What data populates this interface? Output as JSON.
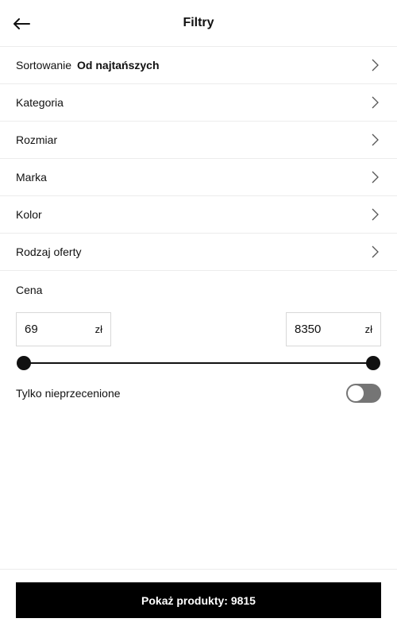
{
  "header": {
    "title": "Filtry",
    "back_icon": "arrow-left-icon"
  },
  "filters": [
    {
      "label": "Sortowanie",
      "value": "Od najtańszych"
    },
    {
      "label": "Kategoria"
    },
    {
      "label": "Rozmiar"
    },
    {
      "label": "Marka"
    },
    {
      "label": "Kolor"
    },
    {
      "label": "Rodzaj oferty"
    }
  ],
  "price": {
    "label": "Cena",
    "min": "69",
    "max": "8350",
    "currency": "zł"
  },
  "toggle": {
    "label": "Tylko nieprzecenione",
    "on": false
  },
  "cta": {
    "label": "Pokaż produkty: 9815"
  },
  "colors": {
    "accent": "#000000",
    "toggle_off": "#757575",
    "divider": "#ececec"
  }
}
